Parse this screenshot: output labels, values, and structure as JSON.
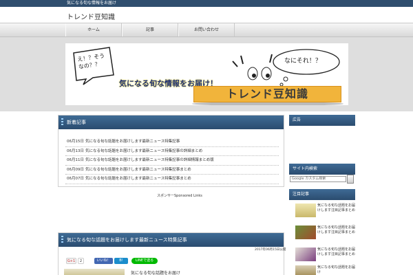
{
  "site": {
    "tagline": "気になる旬な情報をお届け",
    "title": "トレンド豆知識"
  },
  "nav": {
    "items": [
      "ホーム",
      "記事",
      "お問い合わせ"
    ]
  },
  "banner": {
    "bubble_left": "え！？そうなの？？",
    "bubble_right": "なにそれ！？",
    "catch_copy": "気になる旬な情報をお届け！",
    "brand": "トレンド豆知識"
  },
  "news": {
    "heading": "新着記事",
    "rows": [
      {
        "date": "06月15日",
        "title": "気になる旬な話題をお届けします最新ニュース特集記事"
      },
      {
        "date": "06月13日",
        "title": "気になる旬な話題をお届けします最新ニュース特集記事の詳細まとめ"
      },
      {
        "date": "06月11日",
        "title": "気になる旬な話題をお届けします最新ニュース特集記事の詳細情報まとめ版"
      },
      {
        "date": "06月09日",
        "title": "気になる旬な話題をお届けします最新ニュース特集記事まとめ"
      },
      {
        "date": "06月07日",
        "title": "気になる旬な話題をお届けします最新ニュース特集記事まとめ"
      }
    ]
  },
  "sponsor_label": "スポンサーSponsored Links",
  "article": {
    "heading": "気になる旬な話題をお届けします最新ニュース特集記事",
    "meta": "2017年06月15日公開",
    "first_line": "気になる旬な話題をお届け"
  },
  "share": {
    "gplus": "G+1",
    "gplus_count": "2",
    "like": "いいね！",
    "like_count": "0",
    "hatena": "B!",
    "hatena_count": "0",
    "line": "LINEで送る"
  },
  "sidebar": {
    "box1_heading": "広告",
    "search_heading": "サイト内検索",
    "search_placeholder": "Google カスタム検索",
    "pickup_heading": "注目記事",
    "pickup": [
      {
        "title": "気になる旬な話題をお届けします注目記事まとめ"
      },
      {
        "title": "気になる旬な話題をお届けします注目記事まとめ"
      },
      {
        "title": "気になる旬な話題をお届けします注目記事まとめ"
      },
      {
        "title": "気になる旬な話題をお届け"
      }
    ]
  },
  "colors": {
    "topbar": "#2f4e6e",
    "heading_bar": "#34597f",
    "banner_brand": "#f1b43b"
  }
}
